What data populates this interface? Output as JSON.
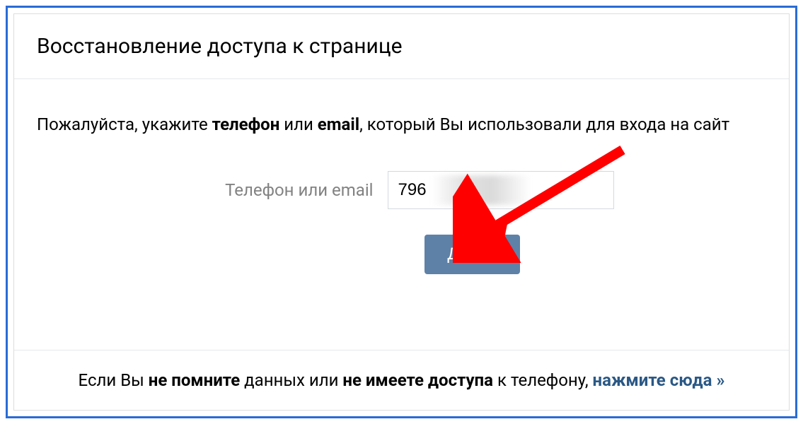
{
  "header": {
    "title": "Восстановление доступа к странице"
  },
  "body": {
    "instruction_prefix": "Пожалуйста, укажите ",
    "instruction_bold1": "телефон",
    "instruction_mid": " или ",
    "instruction_bold2": "email",
    "instruction_suffix": ", который Вы использовали для входа на сайт",
    "input_label": "Телефон или email",
    "input_value": "796",
    "submit_label": "Далее"
  },
  "footer": {
    "prefix": "Если Вы ",
    "bold1": "не помните",
    "mid1": " данных или ",
    "bold2": "не имеете доступа",
    "mid2": " к телефону, ",
    "link_text": "нажмите сюда »"
  },
  "colors": {
    "frame_border": "#2a6cd6",
    "button_bg": "#5e81a8",
    "link_color": "#2a5885",
    "label_gray": "#828282",
    "arrow_color": "#ff0000"
  }
}
